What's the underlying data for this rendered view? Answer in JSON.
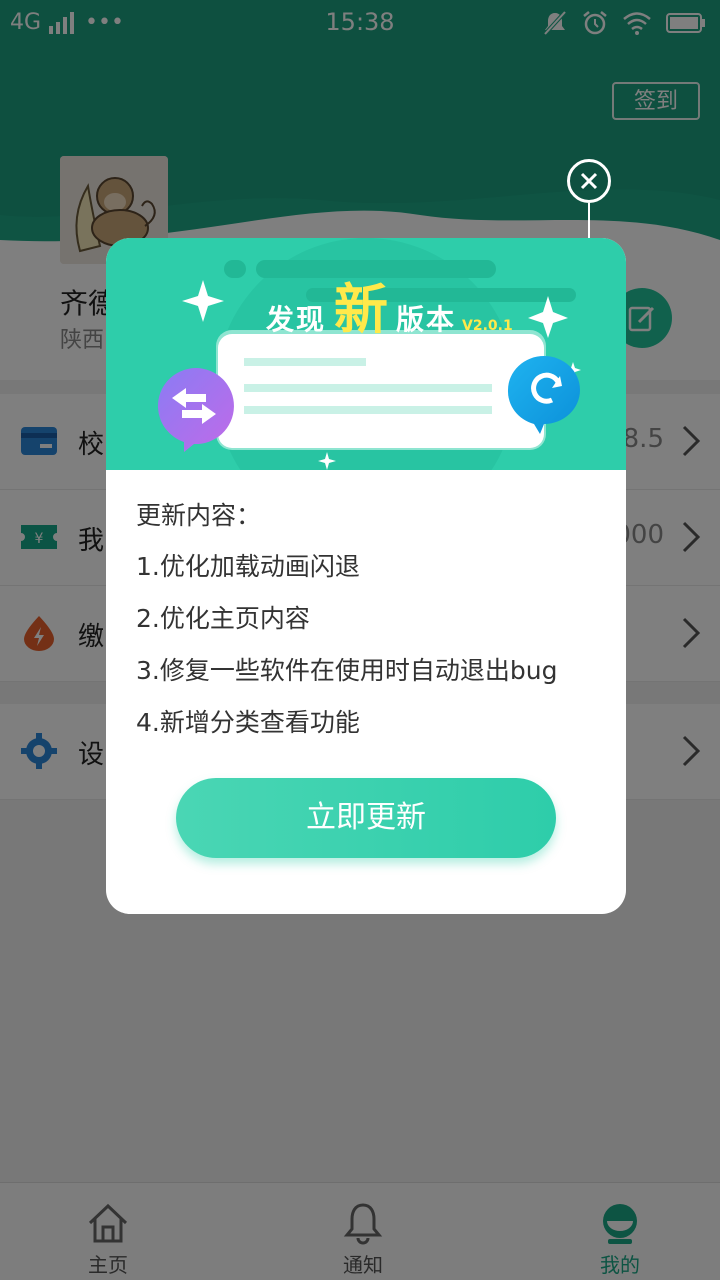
{
  "status_bar": {
    "network": "4G",
    "more": "•••",
    "time": "15:38"
  },
  "header": {
    "signin_label": "签到",
    "user_name": "齐德",
    "user_region": "陕西"
  },
  "menu": [
    {
      "label": "校",
      "value": "8.5"
    },
    {
      "label": "我",
      "value": "000"
    },
    {
      "label": "缴",
      "value": ""
    },
    {
      "label": "设",
      "value": ""
    }
  ],
  "tabs": [
    {
      "label": "主页",
      "icon": "home-icon"
    },
    {
      "label": "通知",
      "icon": "bell-icon"
    },
    {
      "label": "我的",
      "icon": "profile-icon"
    }
  ],
  "modal": {
    "title_prefix": "发现",
    "title_highlight": "新",
    "title_suffix": "版本",
    "version": "V2.0.1",
    "content_title": "更新内容：",
    "items": [
      "1.优化加载动画闪退",
      "2.优化主页内容",
      "3.修复一些软件在使用时自动退出bug",
      "4.新增分类查看功能"
    ],
    "update_button": "立即更新"
  },
  "colors": {
    "accent": "#2ecdaa",
    "accent_dark": "#1aa886",
    "highlight": "#ffe94a"
  }
}
